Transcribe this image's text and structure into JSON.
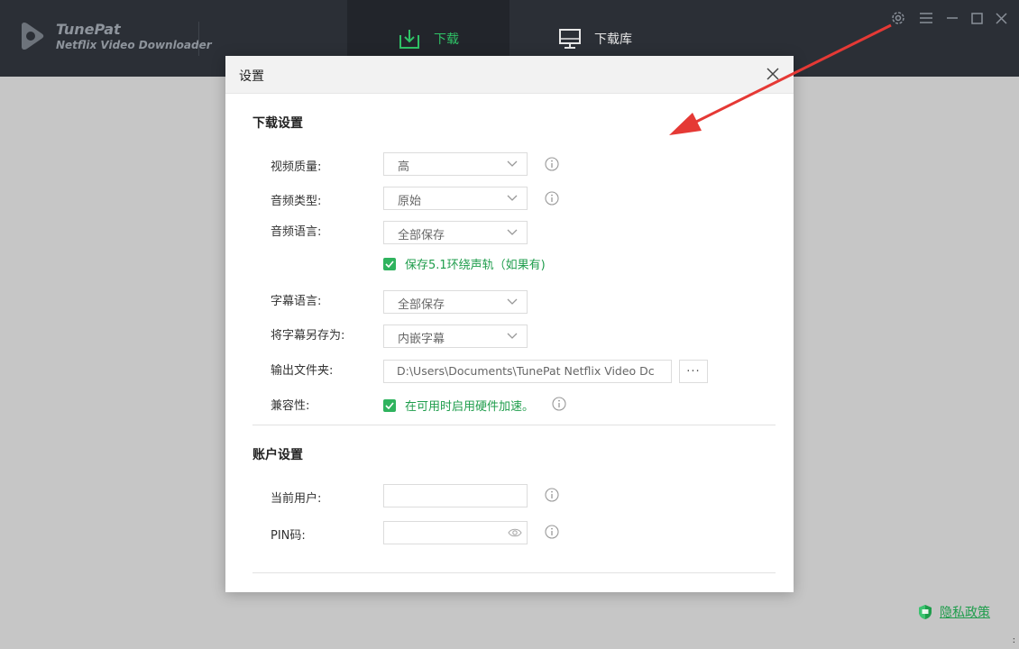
{
  "app": {
    "brand_name": "TunePat",
    "brand_subtitle": "Netflix Video Downloader"
  },
  "tabs": [
    {
      "label": "下载",
      "icon": "download-tray-icon",
      "active": true
    },
    {
      "label": "下载库",
      "icon": "monitor-icon",
      "active": false
    }
  ],
  "window_controls": [
    "gear-icon",
    "menu-icon",
    "minimize-icon",
    "maximize-icon",
    "close-icon"
  ],
  "dialog": {
    "title": "设置",
    "download_section": {
      "title": "下载设置",
      "video_quality": {
        "label": "视频质量:",
        "value": "高"
      },
      "audio_type": {
        "label": "音频类型:",
        "value": "原始"
      },
      "audio_language": {
        "label": "音频语言:",
        "value": "全部保存"
      },
      "keep_51": {
        "label": "保存5.1环绕声轨（如果有)",
        "checked": true
      },
      "subtitle_language": {
        "label": "字幕语言:",
        "value": "全部保存"
      },
      "save_subtitle_as": {
        "label": "将字幕另存为:",
        "value": "内嵌字幕"
      },
      "output_folder": {
        "label": "输出文件夹:",
        "value": "D:\\Users\\Documents\\TunePat Netflix Video Dc",
        "browse_label": "···"
      },
      "compatibility": {
        "label": "兼容性:",
        "option_label": "在可用时启用硬件加速。",
        "checked": true
      }
    },
    "account_section": {
      "title": "账户设置",
      "current_user": {
        "label": "当前用户:",
        "value": ""
      },
      "pin": {
        "label": "PIN码:",
        "value": ""
      }
    }
  },
  "privacy": {
    "label": "隐私政策"
  },
  "colors": {
    "titlebar": "#2b2f36",
    "accent_green": "#2fb35e",
    "annotation_arrow": "#e53935"
  }
}
